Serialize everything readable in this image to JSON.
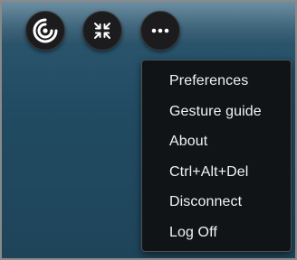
{
  "toolbar": {
    "buttons": [
      {
        "icon": "citrix-logo-icon"
      },
      {
        "icon": "restore-window-icon"
      },
      {
        "icon": "more-options-icon"
      }
    ]
  },
  "menu": {
    "items": [
      {
        "label": "Preferences"
      },
      {
        "label": "Gesture guide"
      },
      {
        "label": "About"
      },
      {
        "label": "Ctrl+Alt+Del"
      },
      {
        "label": "Disconnect"
      },
      {
        "label": "Log Off"
      }
    ]
  },
  "colors": {
    "background": "#1e4459",
    "menu_background": "#101416",
    "menu_text": "#f2f2f2",
    "button_background": "#1c1c1e"
  }
}
